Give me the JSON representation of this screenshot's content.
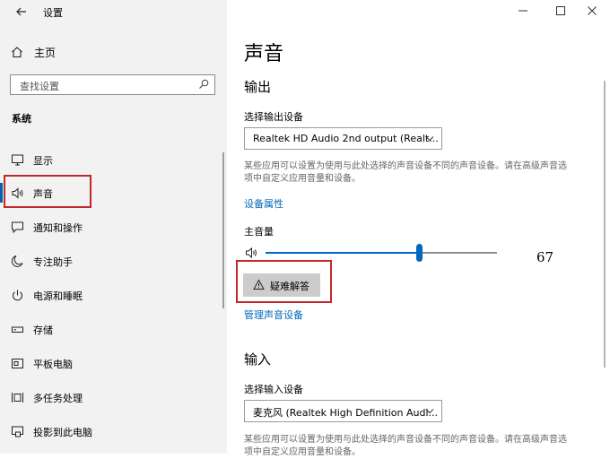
{
  "window": {
    "title": "设置"
  },
  "sidebar": {
    "home_label": "主页",
    "search_placeholder": "查找设置",
    "section_header": "系统",
    "items": [
      {
        "label": "显示",
        "icon": "monitor-icon"
      },
      {
        "label": "声音",
        "icon": "speaker-icon"
      },
      {
        "label": "通知和操作",
        "icon": "notification-icon"
      },
      {
        "label": "专注助手",
        "icon": "moon-icon"
      },
      {
        "label": "电源和睡眠",
        "icon": "power-icon"
      },
      {
        "label": "存储",
        "icon": "storage-icon"
      },
      {
        "label": "平板电脑",
        "icon": "tablet-icon"
      },
      {
        "label": "多任务处理",
        "icon": "multitask-icon"
      },
      {
        "label": "投影到此电脑",
        "icon": "project-icon"
      }
    ],
    "selected_index": 1
  },
  "main": {
    "title": "声音",
    "output": {
      "heading": "输出",
      "device_label": "选择输出设备",
      "device_value": "Realtek HD Audio 2nd output (Realt...",
      "description": "某些应用可以设置为使用与此处选择的声音设备不同的声音设备。请在高级声音选项中自定义应用音量和设备。",
      "properties_link": "设备属性",
      "volume_label": "主音量",
      "volume_value": "67",
      "troubleshoot_label": "疑难解答",
      "manage_link": "管理声音设备"
    },
    "input": {
      "heading": "输入",
      "device_label": "选择输入设备",
      "device_value": "麦克风 (Realtek High Definition Audi...",
      "description": "某些应用可以设置为使用与此处选择的声音设备不同的声音设备。请在高级声音选项中自定义应用音量和设备。"
    }
  },
  "colors": {
    "accent": "#0067c0",
    "highlight": "#c0282d"
  }
}
